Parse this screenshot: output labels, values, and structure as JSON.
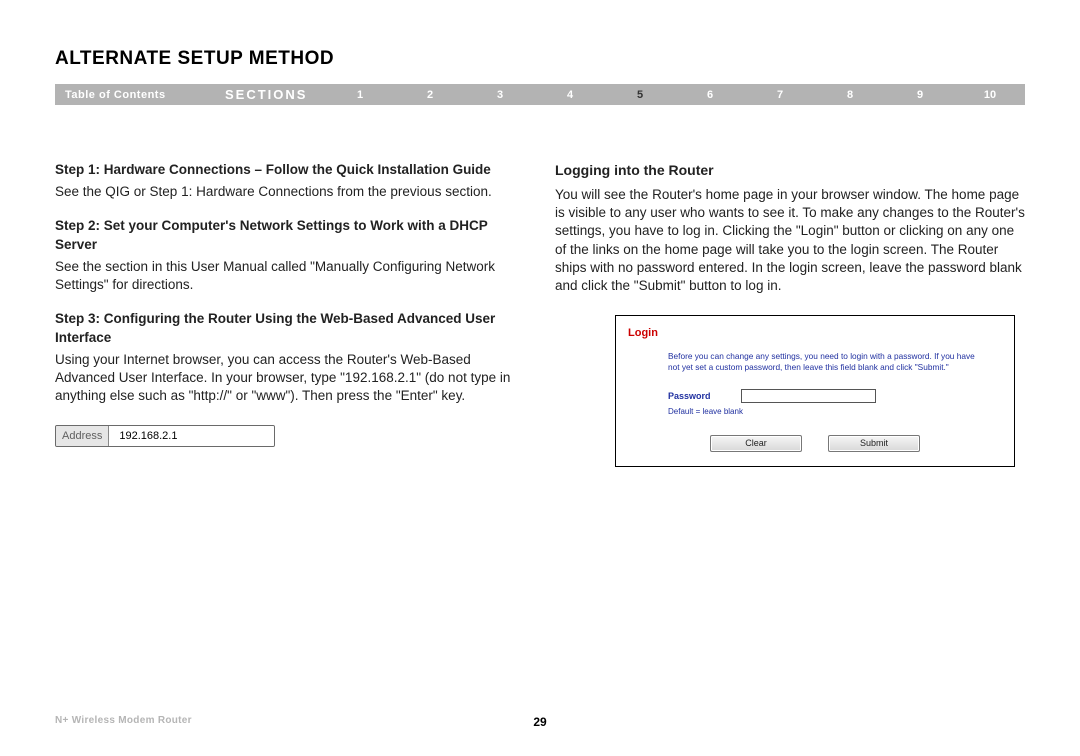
{
  "page_title": "ALTERNATE SETUP METHOD",
  "nav": {
    "toc": "Table of Contents",
    "sections_label": "SECTIONS",
    "numbers": [
      "1",
      "2",
      "3",
      "4",
      "5",
      "6",
      "7",
      "8",
      "9",
      "10"
    ],
    "active_index": 4
  },
  "left": {
    "step1_heading": "Step 1: Hardware Connections – Follow the Quick Installation Guide",
    "step1_body": "See the QIG or Step 1: Hardware Connections from the previous section.",
    "step2_heading": "Step 2: Set your Computer's Network Settings to Work with a DHCP Server",
    "step2_body": "See the section in this User Manual called \"Manually Configuring Network Settings\" for directions.",
    "step3_heading": "Step 3: Configuring the Router Using the Web-Based Advanced User Interface",
    "step3_body": "Using your Internet browser, you can access the Router's Web-Based Advanced User Interface. In your browser, type \"192.168.2.1\" (do not type in anything else such as \"http://\" or \"www\"). Then press the \"Enter\" key.",
    "address_label": "Address",
    "address_value": "192.168.2.1"
  },
  "right": {
    "heading": "Logging into the Router",
    "body": "You will see the Router's home page in your browser window. The home page is visible to any user who wants to see it. To make any changes to the Router's settings, you have to log in. Clicking the \"Login\" button or clicking on any one of the links on the home page will take you to the login screen. The Router ships with no password entered. In the login screen, leave the password blank and click the \"Submit\" button to log in.",
    "login": {
      "header": "Login",
      "instruction": "Before you can change any settings, you need to login with a password. If you have not yet set a custom password, then leave this field blank and click \"Submit.\"",
      "password_label": "Password",
      "hint": "Default = leave blank",
      "clear_btn": "Clear",
      "submit_btn": "Submit"
    }
  },
  "footer": {
    "product": "N+ Wireless Modem Router",
    "page_number": "29"
  }
}
